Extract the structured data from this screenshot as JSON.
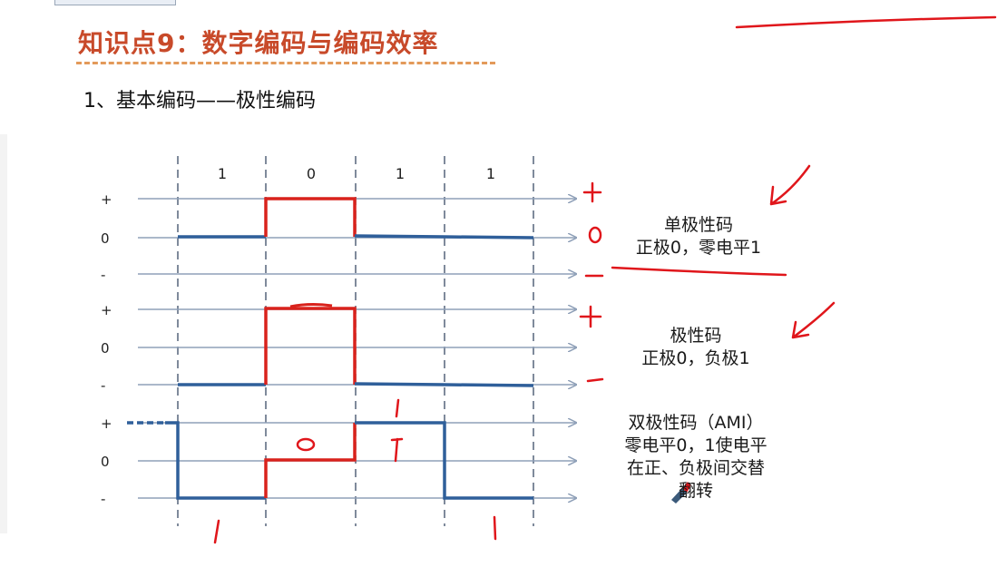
{
  "header": {
    "title": "知识点9：数字编码与编码效率",
    "subtitle": "1、基本编码——极性编码"
  },
  "bits": [
    "1",
    "0",
    "1",
    "1"
  ],
  "rows": [
    {
      "levels": [
        "+",
        "0",
        "-"
      ]
    },
    {
      "levels": [
        "+",
        "0",
        "-"
      ]
    },
    {
      "levels": [
        "+",
        "0",
        "-"
      ]
    }
  ],
  "codes": [
    {
      "name": "单极性码",
      "rule": "正极0，零电平1"
    },
    {
      "name": "极性码",
      "rule": "正极0，负极1"
    },
    {
      "name": "双极性码（AMI）",
      "rule_line1": "零电平0，1使电平",
      "rule_line2": "在正、负极间交替",
      "rule_line3": "翻转"
    }
  ],
  "annotations": {
    "row1": [
      "+",
      "0",
      "−"
    ],
    "row2": [
      "+",
      "−"
    ],
    "ami_bits": [
      "1",
      "0",
      "1",
      "1"
    ]
  },
  "colors": {
    "signal_blue": "#2f5f9a",
    "signal_red": "#d9221c",
    "axis": "#8fa0b8",
    "title": "#c84a2a",
    "ink": "#e0161b"
  }
}
